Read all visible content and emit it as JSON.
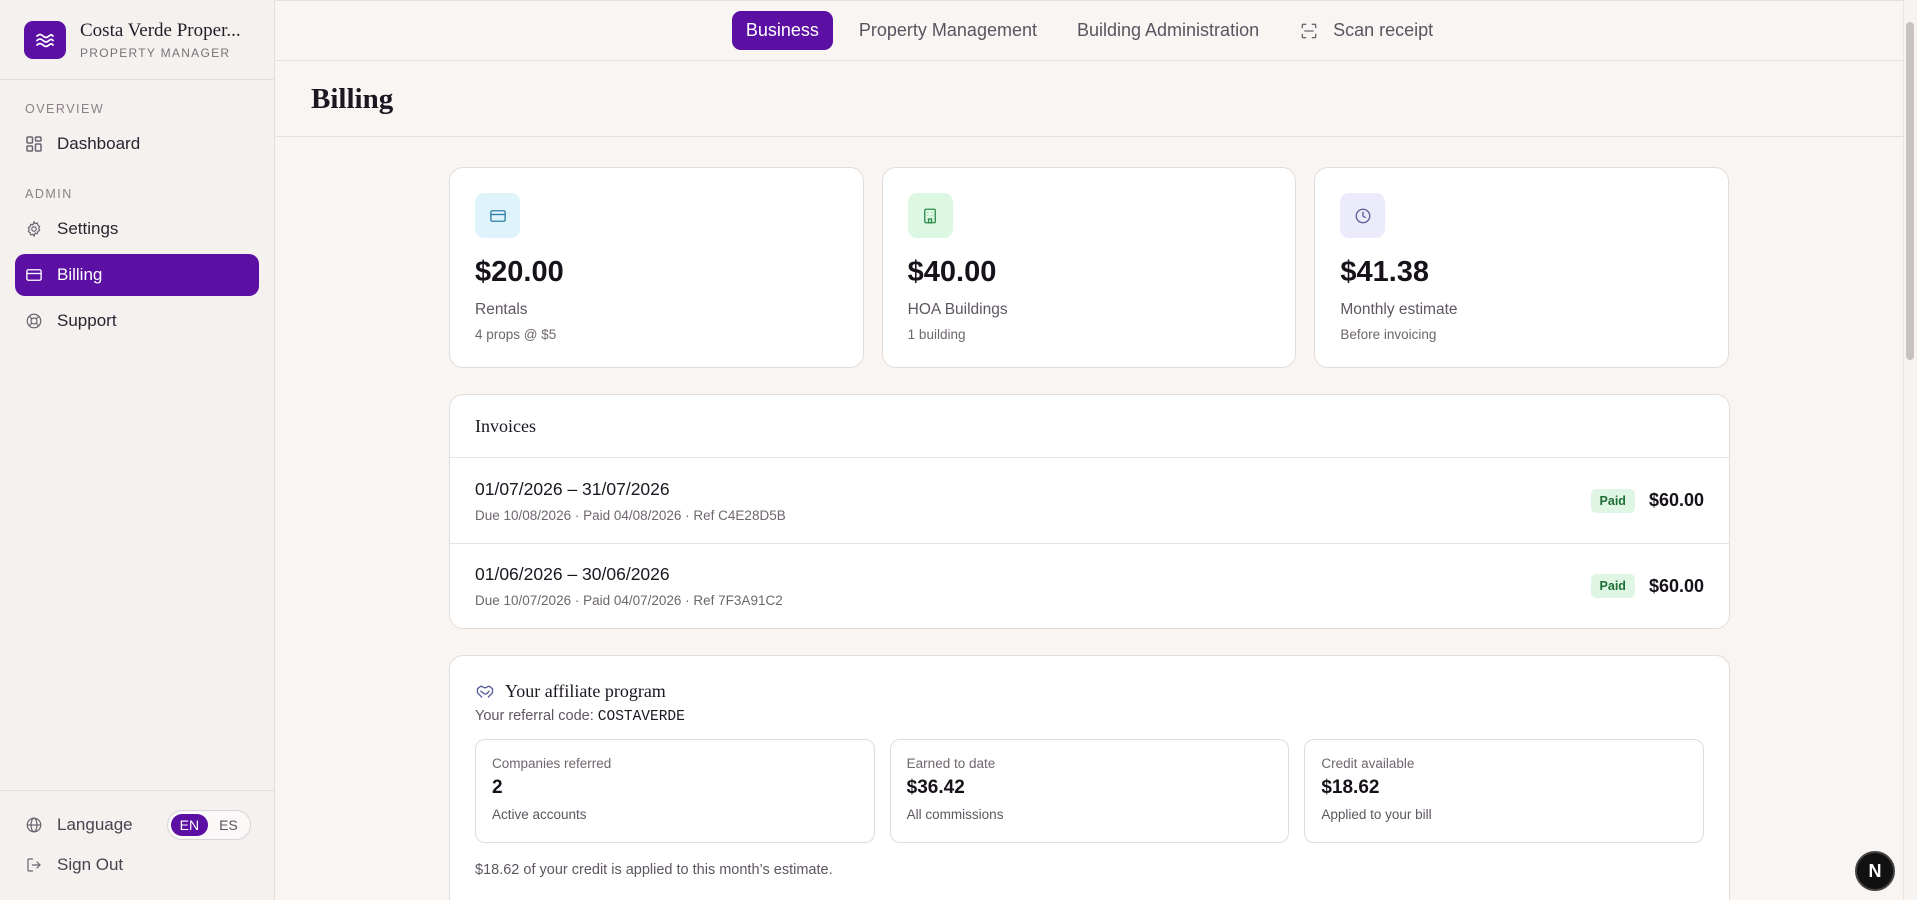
{
  "brand": {
    "name": "Costa Verde Proper...",
    "subtitle": "PROPERTY MANAGER"
  },
  "sidebar": {
    "overview_label": "OVERVIEW",
    "admin_label": "ADMIN",
    "items": [
      {
        "label": "Dashboard",
        "icon": "dashboard-grid-icon"
      },
      {
        "label": "Settings",
        "icon": "gear-icon"
      },
      {
        "label": "Billing",
        "icon": "credit-card-icon",
        "active": true
      },
      {
        "label": "Support",
        "icon": "lifebuoy-icon"
      }
    ],
    "language_label": "Language",
    "languages": [
      "EN",
      "ES"
    ],
    "selected_language": "EN",
    "signout_label": "Sign Out"
  },
  "topnav": {
    "tabs": [
      "Business",
      "Property Management",
      "Building Administration"
    ],
    "active_tab": "Business",
    "scan_label": "Scan receipt"
  },
  "page": {
    "title": "Billing"
  },
  "stats": [
    {
      "value": "$20.00",
      "label": "Rentals",
      "sub": "4 props @ $5",
      "icon": "credit-card-icon",
      "color": "#dff3fb"
    },
    {
      "value": "$40.00",
      "label": "HOA Buildings",
      "sub": "1 building",
      "icon": "building-icon",
      "color": "#dcf7e2"
    },
    {
      "value": "$41.38",
      "label": "Monthly estimate",
      "sub": "Before invoicing",
      "icon": "clock-icon",
      "color": "#ecebfb"
    }
  ],
  "invoices": {
    "title": "Invoices",
    "rows": [
      {
        "period": "01/07/2026 – 31/07/2026",
        "meta": "Due 10/08/2026 · Paid 04/08/2026 · Ref C4E28D5B",
        "status": "Paid",
        "amount": "$60.00"
      },
      {
        "period": "01/06/2026 – 30/06/2026",
        "meta": "Due 10/07/2026 · Paid 04/07/2026 · Ref 7F3A91C2",
        "status": "Paid",
        "amount": "$60.00"
      }
    ]
  },
  "affiliate": {
    "title": "Your affiliate program",
    "code_label": "Your referral code:",
    "code": "COSTAVERDE",
    "cards": [
      {
        "label": "Companies referred",
        "value": "2",
        "sub": "Active accounts"
      },
      {
        "label": "Earned to date",
        "value": "$36.42",
        "sub": "All commissions"
      },
      {
        "label": "Credit available",
        "value": "$18.62",
        "sub": "Applied to your bill"
      }
    ],
    "note": "$18.62 of your credit is applied to this month’s estimate."
  },
  "dev_badge": "N",
  "colors": {
    "accent": "#5b0fa3",
    "background": "#f8f5f2",
    "paid_badge": "#dff6e4"
  }
}
